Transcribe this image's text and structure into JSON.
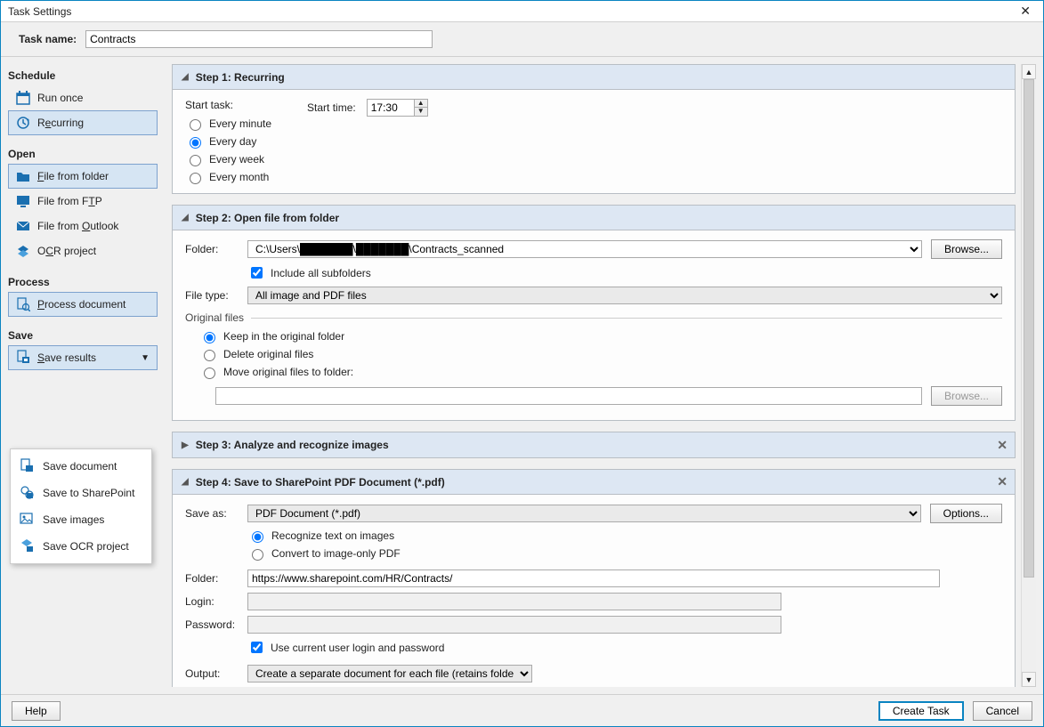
{
  "window": {
    "title": "Task Settings"
  },
  "topbar": {
    "task_name_label": "Task name:",
    "task_name_value": "Contracts"
  },
  "sidebar": {
    "schedule_hdr": "Schedule",
    "run_once": "Run once",
    "recurring": "Recurring",
    "open_hdr": "Open",
    "file_from_folder": "File from folder",
    "file_from_ftp": "File from FTP",
    "file_from_outlook": "File from Outlook",
    "ocr_project": "OCR project",
    "process_hdr": "Process",
    "process_document": "Process document",
    "save_hdr": "Save",
    "save_results": "Save results"
  },
  "popup": {
    "save_document": "Save document",
    "save_sharepoint": "Save to SharePoint",
    "save_images": "Save images",
    "save_ocr_project": "Save OCR project"
  },
  "step1": {
    "title": "Step 1: Recurring",
    "start_task_label": "Start task:",
    "every_minute": "Every minute",
    "every_day": "Every day",
    "every_week": "Every week",
    "every_month": "Every month",
    "start_time_label": "Start time:",
    "start_time_value": "17:30"
  },
  "step2": {
    "title": "Step 2: Open file from folder",
    "folder_label": "Folder:",
    "folder_value": "C:\\Users\\███████\\███████\\Contracts_scanned",
    "browse": "Browse...",
    "include_subfolders": "Include all subfolders",
    "file_type_label": "File type:",
    "file_type_value": "All image and PDF files",
    "original_files_label": "Original files",
    "keep_original": "Keep in the original folder",
    "delete_original": "Delete original files",
    "move_original": "Move original files to folder:",
    "browse2": "Browse..."
  },
  "step3": {
    "title": "Step 3: Analyze and recognize images"
  },
  "step4": {
    "title": "Step 4: Save to SharePoint PDF Document (*.pdf)",
    "save_as_label": "Save as:",
    "save_as_value": "PDF Document (*.pdf)",
    "options": "Options...",
    "recognize_text": "Recognize text on images",
    "convert_image_only": "Convert to image-only PDF",
    "folder_label": "Folder:",
    "folder_value": "https://www.sharepoint.com/HR/Contracts/",
    "login_label": "Login:",
    "password_label": "Password:",
    "use_current_user": "Use current user login and password",
    "output_label": "Output:",
    "output_value": "Create a separate document for each file (retains folder hierar"
  },
  "footer": {
    "help": "Help",
    "create": "Create Task",
    "cancel": "Cancel"
  }
}
